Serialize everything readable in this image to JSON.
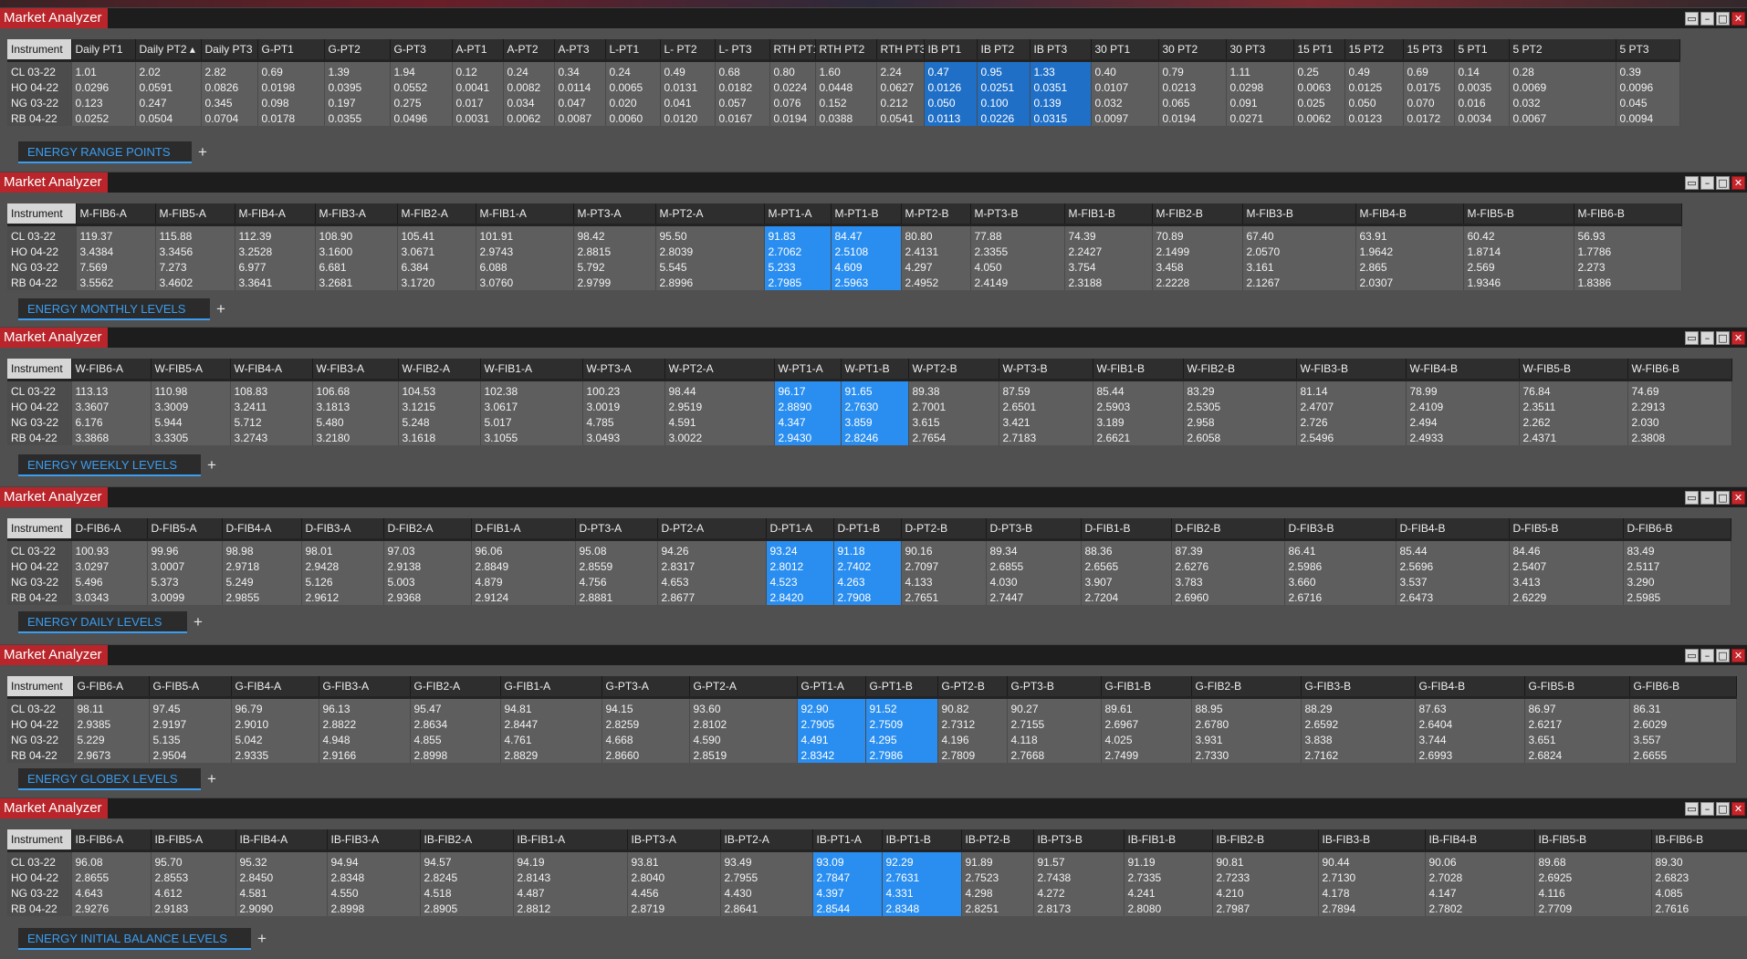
{
  "app": {
    "window_title": "Market Analyzer"
  },
  "panels": [
    {
      "id": "range",
      "tab": "ENERGY RANGE POINTS",
      "columns": [
        "Instrument",
        "Daily PT1",
        "Daily PT2 ▴",
        "Daily PT3",
        "G-PT1",
        "G-PT2",
        "G-PT3",
        "A-PT1",
        "A-PT2",
        "A-PT3",
        "L-PT1",
        "L- PT2",
        "L- PT3",
        "RTH PT1",
        "RTH PT2",
        "RTH PT3",
        "IB PT1",
        "IB PT2",
        "IB PT3",
        "30 PT1",
        "30 PT2",
        "30 PT3",
        "15 PT1",
        "15 PT2",
        "15 PT3",
        "5 PT1",
        "5 PT2",
        "5 PT3"
      ],
      "rows": [
        [
          "CL 03-22",
          "1.01",
          "2.02",
          "2.82",
          "0.69",
          "1.39",
          "1.94",
          "0.12",
          "0.24",
          "0.34",
          "0.24",
          "0.49",
          "0.68",
          "0.80",
          "1.60",
          "2.24",
          "0.47",
          "0.95",
          "1.33",
          "0.40",
          "0.79",
          "1.11",
          "0.25",
          "0.49",
          "0.69",
          "0.14",
          "0.28",
          "0.39"
        ],
        [
          "HO 04-22",
          "0.0296",
          "0.0591",
          "0.0826",
          "0.0198",
          "0.0395",
          "0.0552",
          "0.0041",
          "0.0082",
          "0.0114",
          "0.0065",
          "0.0131",
          "0.0182",
          "0.0224",
          "0.0448",
          "0.0627",
          "0.0126",
          "0.0251",
          "0.0351",
          "0.0107",
          "0.0213",
          "0.0298",
          "0.0063",
          "0.0125",
          "0.0175",
          "0.0035",
          "0.0069",
          "0.0096"
        ],
        [
          "NG 03-22",
          "0.123",
          "0.247",
          "0.345",
          "0.098",
          "0.197",
          "0.275",
          "0.017",
          "0.034",
          "0.047",
          "0.020",
          "0.041",
          "0.057",
          "0.076",
          "0.152",
          "0.212",
          "0.050",
          "0.100",
          "0.139",
          "0.032",
          "0.065",
          "0.091",
          "0.025",
          "0.050",
          "0.070",
          "0.016",
          "0.032",
          "0.045"
        ],
        [
          "RB 04-22",
          "0.0252",
          "0.0504",
          "0.0704",
          "0.0178",
          "0.0355",
          "0.0496",
          "0.0031",
          "0.0062",
          "0.0087",
          "0.0060",
          "0.0120",
          "0.0167",
          "0.0194",
          "0.0388",
          "0.0541",
          "0.0113",
          "0.0226",
          "0.0315",
          "0.0097",
          "0.0194",
          "0.0271",
          "0.0062",
          "0.0123",
          "0.0172",
          "0.0034",
          "0.0067",
          "0.0094"
        ]
      ]
    },
    {
      "id": "monthly",
      "tab": "ENERGY MONTHLY LEVELS",
      "columns": [
        "Instrument",
        "M-FIB6-A",
        "M-FIB5-A",
        "M-FIB4-A",
        "M-FIB3-A",
        "M-FIB2-A",
        "M-FIB1-A",
        "M-PT3-A",
        "M-PT2-A",
        "M-PT1-A",
        "M-PT1-B",
        "M-PT2-B",
        "M-PT3-B",
        "M-FIB1-B",
        "M-FIB2-B",
        "M-FIB3-B",
        "M-FIB4-B",
        "M-FIB5-B",
        "M-FIB6-B"
      ],
      "rows": [
        [
          "CL 03-22",
          "119.37",
          "115.88",
          "112.39",
          "108.90",
          "105.41",
          "101.91",
          "98.42",
          "95.50",
          "91.83",
          "84.47",
          "80.80",
          "77.88",
          "74.39",
          "70.89",
          "67.40",
          "63.91",
          "60.42",
          "56.93"
        ],
        [
          "HO 04-22",
          "3.4384",
          "3.3456",
          "3.2528",
          "3.1600",
          "3.0671",
          "2.9743",
          "2.8815",
          "2.8039",
          "2.7062",
          "2.5108",
          "2.4131",
          "2.3355",
          "2.2427",
          "2.1499",
          "2.0570",
          "1.9642",
          "1.8714",
          "1.7786"
        ],
        [
          "NG 03-22",
          "7.569",
          "7.273",
          "6.977",
          "6.681",
          "6.384",
          "6.088",
          "5.792",
          "5.545",
          "5.233",
          "4.609",
          "4.297",
          "4.050",
          "3.754",
          "3.458",
          "3.161",
          "2.865",
          "2.569",
          "2.273"
        ],
        [
          "RB 04-22",
          "3.5562",
          "3.4602",
          "3.3641",
          "3.2681",
          "3.1720",
          "3.0760",
          "2.9799",
          "2.8996",
          "2.7985",
          "2.5963",
          "2.4952",
          "2.4149",
          "2.3188",
          "2.2228",
          "2.1267",
          "2.0307",
          "1.9346",
          "1.8386"
        ]
      ]
    },
    {
      "id": "weekly",
      "tab": "ENERGY WEEKLY LEVELS",
      "columns": [
        "Instrument",
        "W-FIB6-A",
        "W-FIB5-A",
        "W-FIB4-A",
        "W-FIB3-A",
        "W-FIB2-A",
        "W-FIB1-A",
        "W-PT3-A",
        "W-PT2-A",
        "W-PT1-A",
        "W-PT1-B",
        "W-PT2-B",
        "W-PT3-B",
        "W-FIB1-B",
        "W-FIB2-B",
        "W-FIB3-B",
        "W-FIB4-B",
        "W-FIB5-B",
        "W-FIB6-B"
      ],
      "rows": [
        [
          "CL 03-22",
          "113.13",
          "110.98",
          "108.83",
          "106.68",
          "104.53",
          "102.38",
          "100.23",
          "98.44",
          "96.17",
          "91.65",
          "89.38",
          "87.59",
          "85.44",
          "83.29",
          "81.14",
          "78.99",
          "76.84",
          "74.69"
        ],
        [
          "HO 04-22",
          "3.3607",
          "3.3009",
          "3.2411",
          "3.1813",
          "3.1215",
          "3.0617",
          "3.0019",
          "2.9519",
          "2.8890",
          "2.7630",
          "2.7001",
          "2.6501",
          "2.5903",
          "2.5305",
          "2.4707",
          "2.4109",
          "2.3511",
          "2.2913"
        ],
        [
          "NG 03-22",
          "6.176",
          "5.944",
          "5.712",
          "5.480",
          "5.248",
          "5.017",
          "4.785",
          "4.591",
          "4.347",
          "3.859",
          "3.615",
          "3.421",
          "3.189",
          "2.958",
          "2.726",
          "2.494",
          "2.262",
          "2.030"
        ],
        [
          "RB 04-22",
          "3.3868",
          "3.3305",
          "3.2743",
          "3.2180",
          "3.1618",
          "3.1055",
          "3.0493",
          "3.0022",
          "2.9430",
          "2.8246",
          "2.7654",
          "2.7183",
          "2.6621",
          "2.6058",
          "2.5496",
          "2.4933",
          "2.4371",
          "2.3808"
        ]
      ]
    },
    {
      "id": "daily",
      "tab": "ENERGY DAILY LEVELS",
      "columns": [
        "Instrument",
        "D-FIB6-A",
        "D-FIB5-A",
        "D-FIB4-A",
        "D-FIB3-A",
        "D-FIB2-A",
        "D-FIB1-A",
        "D-PT3-A",
        "D-PT2-A",
        "D-PT1-A",
        "D-PT1-B",
        "D-PT2-B",
        "D-PT3-B",
        "D-FIB1-B",
        "D-FIB2-B",
        "D-FIB3-B",
        "D-FIB4-B",
        "D-FIB5-B",
        "D-FIB6-B"
      ],
      "rows": [
        [
          "CL 03-22",
          "100.93",
          "99.96",
          "98.98",
          "98.01",
          "97.03",
          "96.06",
          "95.08",
          "94.26",
          "93.24",
          "91.18",
          "90.16",
          "89.34",
          "88.36",
          "87.39",
          "86.41",
          "85.44",
          "84.46",
          "83.49"
        ],
        [
          "HO 04-22",
          "3.0297",
          "3.0007",
          "2.9718",
          "2.9428",
          "2.9138",
          "2.8849",
          "2.8559",
          "2.8317",
          "2.8012",
          "2.7402",
          "2.7097",
          "2.6855",
          "2.6565",
          "2.6276",
          "2.5986",
          "2.5696",
          "2.5407",
          "2.5117"
        ],
        [
          "NG 03-22",
          "5.496",
          "5.373",
          "5.249",
          "5.126",
          "5.003",
          "4.879",
          "4.756",
          "4.653",
          "4.523",
          "4.263",
          "4.133",
          "4.030",
          "3.907",
          "3.783",
          "3.660",
          "3.537",
          "3.413",
          "3.290"
        ],
        [
          "RB 04-22",
          "3.0343",
          "3.0099",
          "2.9855",
          "2.9612",
          "2.9368",
          "2.9124",
          "2.8881",
          "2.8677",
          "2.8420",
          "2.7908",
          "2.7651",
          "2.7447",
          "2.7204",
          "2.6960",
          "2.6716",
          "2.6473",
          "2.6229",
          "2.5985"
        ]
      ]
    },
    {
      "id": "globex",
      "tab": "ENERGY GLOBEX LEVELS",
      "columns": [
        "Instrument",
        "G-FIB6-A",
        "G-FIB5-A",
        "G-FIB4-A",
        "G-FIB3-A",
        "G-FIB2-A",
        "G-FIB1-A",
        "G-PT3-A",
        "G-PT2-A",
        "G-PT1-A",
        "G-PT1-B",
        "G-PT2-B",
        "G-PT3-B",
        "G-FIB1-B",
        "G-FIB2-B",
        "G-FIB3-B",
        "G-FIB4-B",
        "G-FIB5-B",
        "G-FIB6-B"
      ],
      "rows": [
        [
          "CL 03-22",
          "98.11",
          "97.45",
          "96.79",
          "96.13",
          "95.47",
          "94.81",
          "94.15",
          "93.60",
          "92.90",
          "91.52",
          "90.82",
          "90.27",
          "89.61",
          "88.95",
          "88.29",
          "87.63",
          "86.97",
          "86.31"
        ],
        [
          "HO 04-22",
          "2.9385",
          "2.9197",
          "2.9010",
          "2.8822",
          "2.8634",
          "2.8447",
          "2.8259",
          "2.8102",
          "2.7905",
          "2.7509",
          "2.7312",
          "2.7155",
          "2.6967",
          "2.6780",
          "2.6592",
          "2.6404",
          "2.6217",
          "2.6029"
        ],
        [
          "NG 03-22",
          "5.229",
          "5.135",
          "5.042",
          "4.948",
          "4.855",
          "4.761",
          "4.668",
          "4.590",
          "4.491",
          "4.295",
          "4.196",
          "4.118",
          "4.025",
          "3.931",
          "3.838",
          "3.744",
          "3.651",
          "3.557"
        ],
        [
          "RB 04-22",
          "2.9673",
          "2.9504",
          "2.9335",
          "2.9166",
          "2.8998",
          "2.8829",
          "2.8660",
          "2.8519",
          "2.8342",
          "2.7986",
          "2.7809",
          "2.7668",
          "2.7499",
          "2.7330",
          "2.7162",
          "2.6993",
          "2.6824",
          "2.6655"
        ]
      ]
    },
    {
      "id": "ib",
      "tab": "ENERGY INITIAL BALANCE LEVELS",
      "columns": [
        "Instrument",
        "IB-FIB6-A",
        "IB-FIB5-A",
        "IB-FIB4-A",
        "IB-FIB3-A",
        "IB-FIB2-A",
        "IB-FIB1-A",
        "IB-PT3-A",
        "IB-PT2-A",
        "IB-PT1-A",
        "IB-PT1-B",
        "IB-PT2-B",
        "IB-PT3-B",
        "IB-FIB1-B",
        "IB-FIB2-B",
        "IB-FIB3-B",
        "IB-FIB4-B",
        "IB-FIB5-B",
        "IB-FIB6-B"
      ],
      "rows": [
        [
          "CL 03-22",
          "96.08",
          "95.70",
          "95.32",
          "94.94",
          "94.57",
          "94.19",
          "93.81",
          "93.49",
          "93.09",
          "92.29",
          "91.89",
          "91.57",
          "91.19",
          "90.81",
          "90.44",
          "90.06",
          "89.68",
          "89.30"
        ],
        [
          "HO 04-22",
          "2.8655",
          "2.8553",
          "2.8450",
          "2.8348",
          "2.8245",
          "2.8143",
          "2.8040",
          "2.7955",
          "2.7847",
          "2.7631",
          "2.7523",
          "2.7438",
          "2.7335",
          "2.7233",
          "2.7130",
          "2.7028",
          "2.6925",
          "2.6823"
        ],
        [
          "NG 03-22",
          "4.643",
          "4.612",
          "4.581",
          "4.550",
          "4.518",
          "4.487",
          "4.456",
          "4.430",
          "4.397",
          "4.331",
          "4.298",
          "4.272",
          "4.241",
          "4.210",
          "4.178",
          "4.147",
          "4.116",
          "4.085"
        ],
        [
          "RB 04-22",
          "2.9276",
          "2.9183",
          "2.9090",
          "2.8998",
          "2.8905",
          "2.8812",
          "2.8719",
          "2.8641",
          "2.8544",
          "2.8348",
          "2.8251",
          "2.8173",
          "2.8080",
          "2.7987",
          "2.7894",
          "2.7802",
          "2.7709",
          "2.7616"
        ]
      ]
    }
  ],
  "icons": {
    "minimize": "minimize-icon",
    "maximize": "maximize-icon",
    "restore": "restore-icon",
    "close": "close-icon",
    "add_tab": "plus-icon"
  },
  "colors": {
    "title_tab": "#b9252a",
    "highlight": "#2a8ef0",
    "tab_text": "#3b9df0",
    "header": "#2e2e2e",
    "cell": "#5e5e5e"
  }
}
